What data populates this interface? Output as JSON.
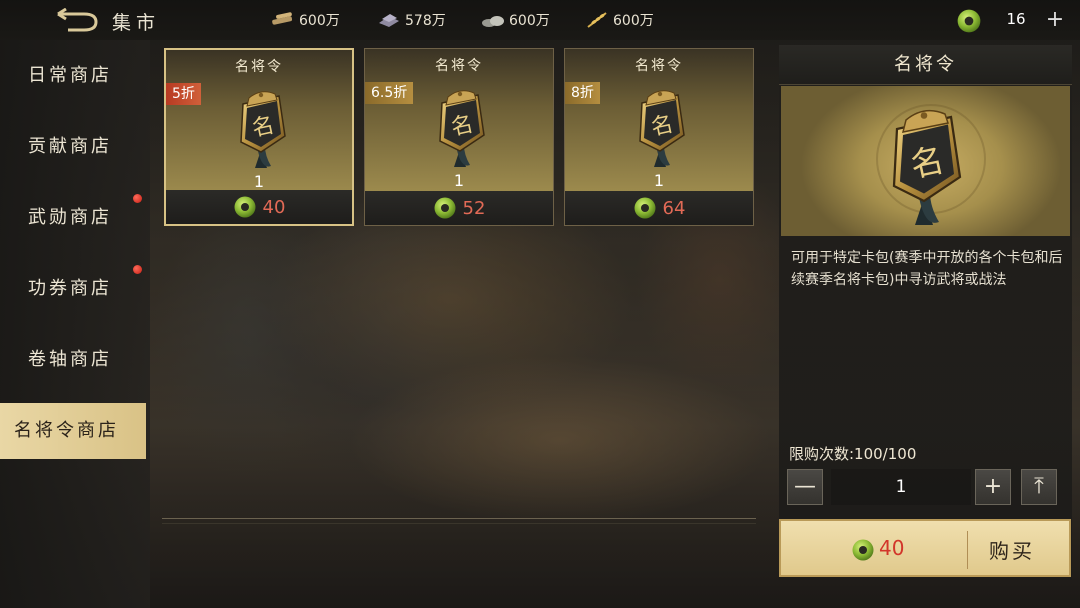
{
  "header": {
    "title": "集市",
    "resources": [
      {
        "icon": "wood-icon",
        "value": "600万"
      },
      {
        "icon": "iron-icon",
        "value": "578万"
      },
      {
        "icon": "stone-icon",
        "value": "600万"
      },
      {
        "icon": "grain-icon",
        "value": "600万"
      }
    ],
    "jade": "16",
    "add": "+"
  },
  "sidebar": {
    "items": [
      {
        "label": "日常商店",
        "dot": false
      },
      {
        "label": "贡献商店",
        "dot": false
      },
      {
        "label": "武勋商店",
        "dot": true
      },
      {
        "label": "功券商店",
        "dot": true
      },
      {
        "label": "卷轴商店",
        "dot": false
      },
      {
        "label": "名将令商店",
        "dot": false,
        "active": true
      }
    ]
  },
  "cards": [
    {
      "name": "名将令",
      "discount": "5折",
      "qty": "1",
      "price": "40"
    },
    {
      "name": "名将令",
      "discount": "6.5折",
      "qty": "1",
      "price": "52"
    },
    {
      "name": "名将令",
      "discount": "8折",
      "qty": "1",
      "price": "64"
    }
  ],
  "detail": {
    "title": "名将令",
    "description": "可用于特定卡包(赛季中开放的各个卡包和后续赛季名将卡包)中寻访武将或战法",
    "limit": "限购次数:100/100",
    "minus": "—",
    "quantity": "1",
    "plus": "+",
    "max": "⤒",
    "buy_price": "40",
    "buy_label": "购买"
  },
  "colors": {
    "gold": "#d7c285",
    "price_red": "#e26a56",
    "jade_green": "#7fae2f"
  }
}
